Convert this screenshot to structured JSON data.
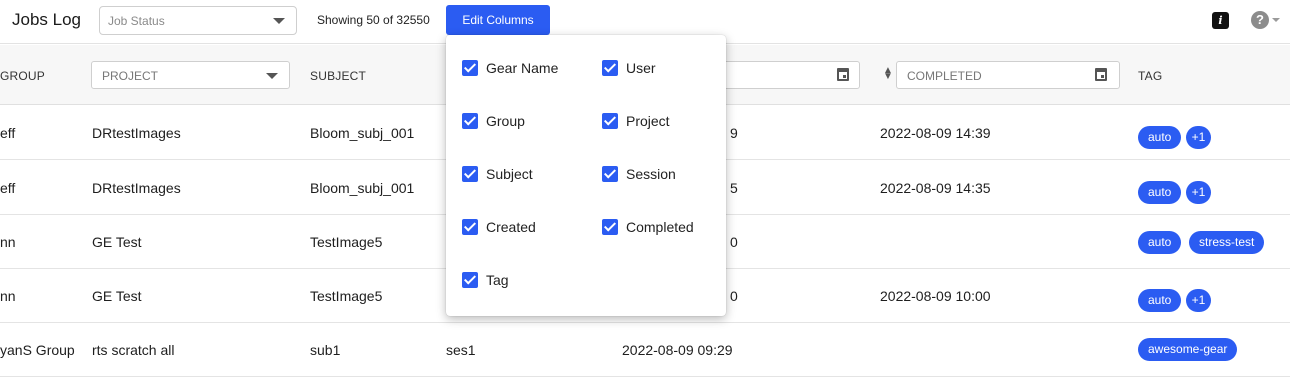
{
  "header": {
    "title": "Jobs Log",
    "job_status_placeholder": "Job Status",
    "showing_text": "Showing 50 of 32550",
    "edit_columns_label": "Edit Columns",
    "info_icon_glyph": "i",
    "help_icon_glyph": "?"
  },
  "columns": {
    "group_label": "GROUP",
    "project_placeholder": "PROJECT",
    "subject_label": "SUBJECT",
    "completed_placeholder": "COMPLETED",
    "tag_label": "TAG"
  },
  "rows": [
    {
      "group": "eff",
      "project": "DRtestImages",
      "subject": "Bloom_subj_001",
      "session": "",
      "created": "9",
      "completed": "2022-08-09 14:39",
      "tags": [
        "auto"
      ],
      "more": "+1"
    },
    {
      "group": "eff",
      "project": "DRtestImages",
      "subject": "Bloom_subj_001",
      "session": "",
      "created": "5",
      "completed": "2022-08-09 14:35",
      "tags": [
        "auto"
      ],
      "more": "+1"
    },
    {
      "group": "nn",
      "project": "GE Test",
      "subject": "TestImage5",
      "session": "",
      "created": "0",
      "completed": "",
      "tags": [
        "auto",
        "stress-test"
      ],
      "more": ""
    },
    {
      "group": "nn",
      "project": "GE Test",
      "subject": "TestImage5",
      "session": "",
      "created": "0",
      "completed": "2022-08-09 10:00",
      "tags": [
        "auto"
      ],
      "more": "+1"
    },
    {
      "group": "yanS Group",
      "project": "rts scratch all",
      "subject": "sub1",
      "session": "ses1",
      "created": "2022-08-09 09:29",
      "completed": "",
      "tags": [
        "awesome-gear"
      ],
      "more": ""
    }
  ],
  "edit_columns_menu": {
    "items": [
      {
        "label": "Gear Name",
        "checked": true
      },
      {
        "label": "User",
        "checked": true
      },
      {
        "label": "Group",
        "checked": true
      },
      {
        "label": "Project",
        "checked": true
      },
      {
        "label": "Subject",
        "checked": true
      },
      {
        "label": "Session",
        "checked": true
      },
      {
        "label": "Created",
        "checked": true
      },
      {
        "label": "Completed",
        "checked": true
      },
      {
        "label": "Tag",
        "checked": true
      }
    ]
  },
  "colors": {
    "accent": "#2b5cf2",
    "header_bg": "#f7f7f7",
    "border": "#e4e4e4"
  },
  "icons": {
    "status_caret": "chevron-down-icon",
    "project_caret": "chevron-down-icon",
    "date_picker": "calendar-icon",
    "sort": "sort-icon",
    "info": "info-icon",
    "help": "help-icon",
    "checkbox": "checkbox-checked-icon"
  }
}
